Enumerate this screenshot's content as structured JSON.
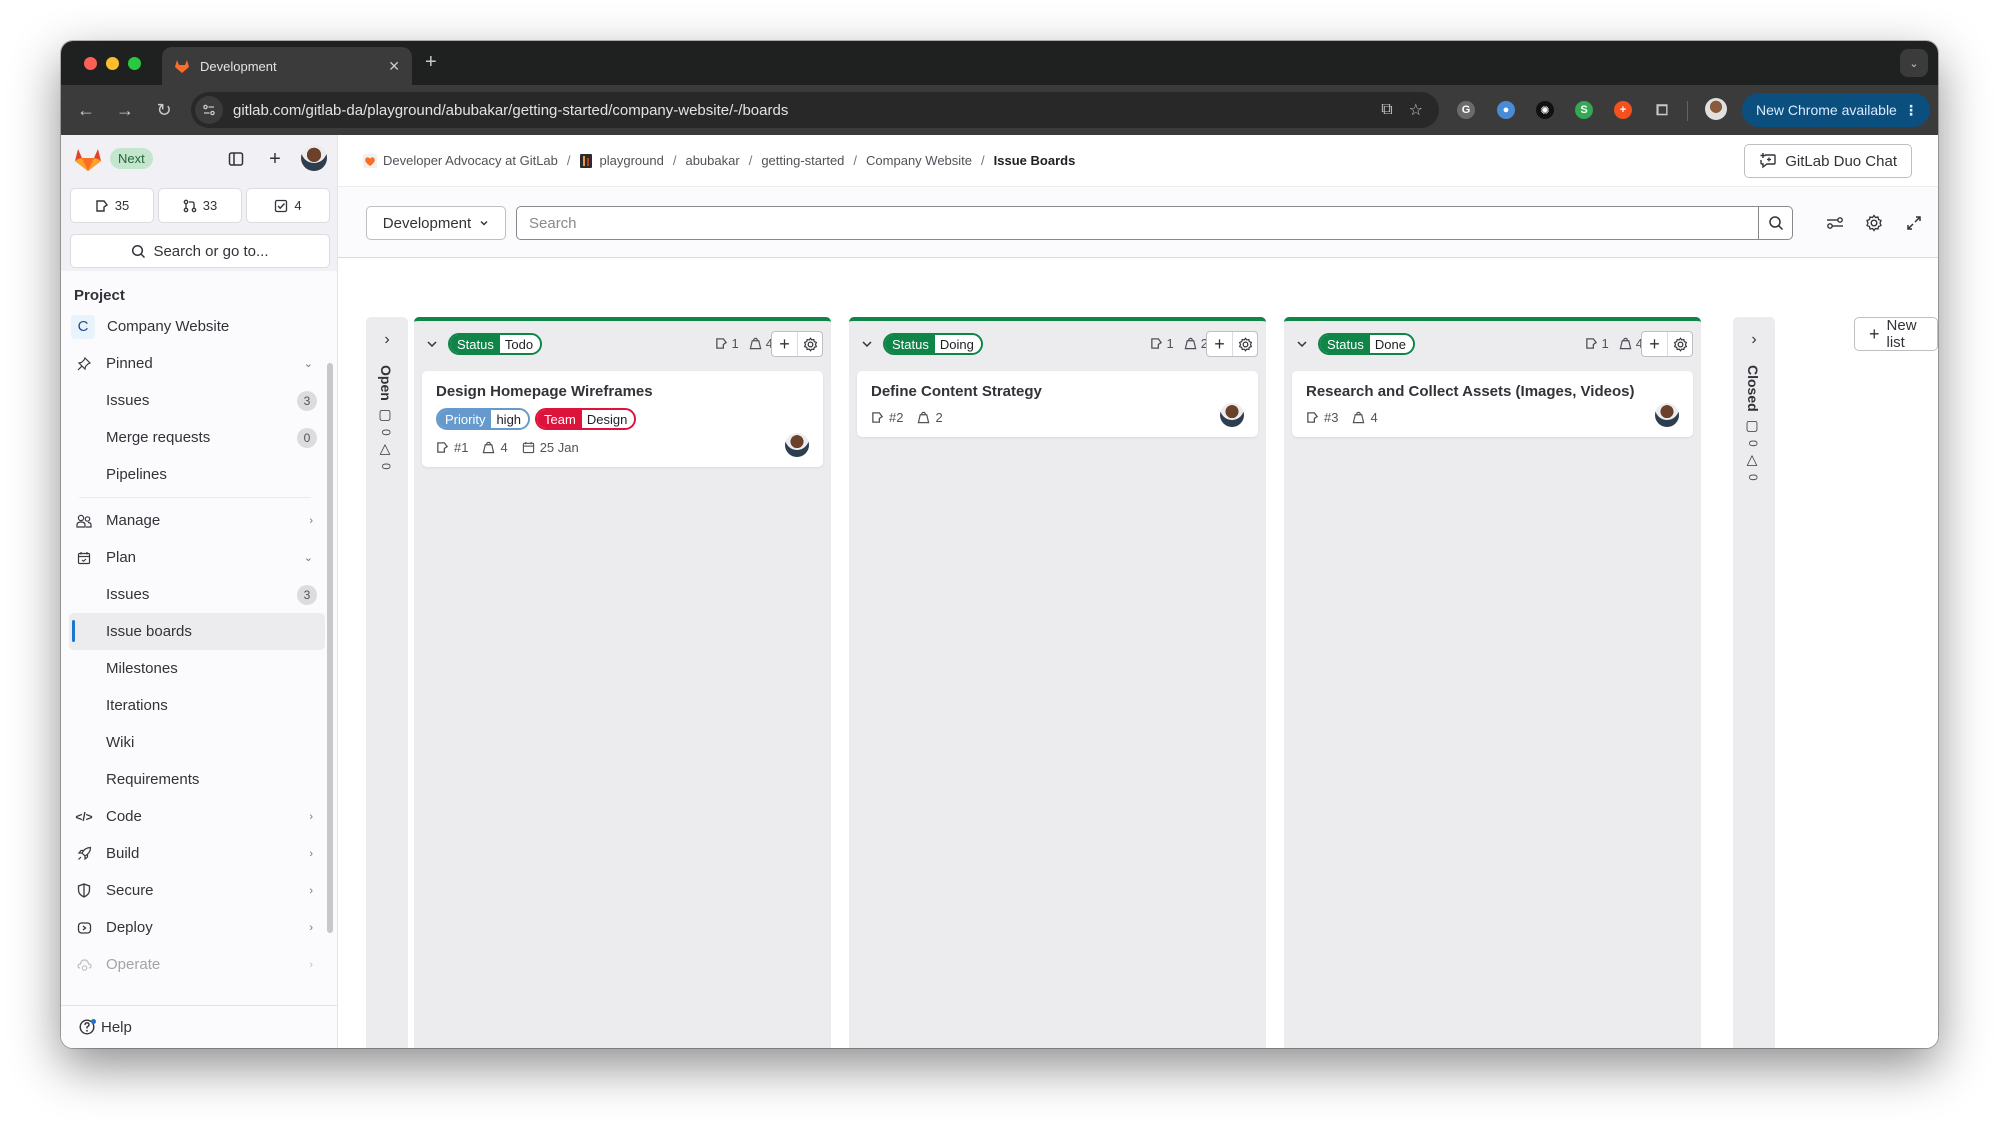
{
  "browser": {
    "tab_title": "Development",
    "url": "gitlab.com/gitlab-da/playground/abubakar/getting-started/company-website/-/boards",
    "update_button": "New Chrome available",
    "extensions": [
      {
        "name": "grammarly",
        "glyph": "G",
        "color": "#6b6b6b"
      },
      {
        "name": "extension-blue",
        "glyph": "●",
        "color": "#4a8bd6"
      },
      {
        "name": "extension-dark",
        "glyph": "✺",
        "color": "#111111"
      },
      {
        "name": "extension-green",
        "glyph": "S",
        "color": "#34a853"
      },
      {
        "name": "extension-orange",
        "glyph": "+",
        "color": "#f4511e"
      }
    ]
  },
  "sidebar": {
    "badge": "Next",
    "counters": [
      {
        "icon": "issues-icon",
        "count": "35"
      },
      {
        "icon": "merge-request-icon",
        "count": "33"
      },
      {
        "icon": "todo-icon",
        "count": "4"
      }
    ],
    "search_label": "Search or go to...",
    "section_title": "Project",
    "project": {
      "initial": "C",
      "name": "Company Website"
    },
    "items": [
      {
        "label": "Pinned",
        "icon": "pin-icon",
        "chevron": "down"
      },
      {
        "label": "Issues",
        "sub": true,
        "count": "3"
      },
      {
        "label": "Merge requests",
        "sub": true,
        "count": "0"
      },
      {
        "label": "Pipelines",
        "sub": true
      },
      {
        "label": "Manage",
        "icon": "users-icon",
        "chevron": "right"
      },
      {
        "label": "Plan",
        "icon": "calendar-icon",
        "chevron": "down"
      },
      {
        "label": "Issues",
        "sub": true,
        "count": "3"
      },
      {
        "label": "Issue boards",
        "sub": true,
        "active": true
      },
      {
        "label": "Milestones",
        "sub": true
      },
      {
        "label": "Iterations",
        "sub": true
      },
      {
        "label": "Wiki",
        "sub": true
      },
      {
        "label": "Requirements",
        "sub": true
      },
      {
        "label": "Code",
        "icon": "code-icon",
        "chevron": "right"
      },
      {
        "label": "Build",
        "icon": "rocket-icon",
        "chevron": "right"
      },
      {
        "label": "Secure",
        "icon": "shield-icon",
        "chevron": "right"
      },
      {
        "label": "Deploy",
        "icon": "deploy-icon",
        "chevron": "right"
      },
      {
        "label": "Operate",
        "icon": "cloud-icon",
        "chevron": "right",
        "faded": true
      }
    ],
    "help_label": "Help"
  },
  "breadcrumb": [
    {
      "label": "Developer Advocacy at GitLab",
      "icon": "group-avatar"
    },
    {
      "label": "playground",
      "icon": "subgroup-avatar"
    },
    {
      "label": "abubakar"
    },
    {
      "label": "getting-started"
    },
    {
      "label": "Company Website"
    },
    {
      "label": "Issue Boards",
      "current": true
    }
  ],
  "header": {
    "duo_chat_label": "GitLab Duo Chat"
  },
  "filter": {
    "board_name": "Development",
    "search_placeholder": "Search",
    "search_value": ""
  },
  "board": {
    "open_list": {
      "title": "Open",
      "issues": "0",
      "weight": "0"
    },
    "closed_list": {
      "title": "Closed",
      "issues": "0",
      "weight": "0"
    },
    "new_list_label": "New list",
    "lists": [
      {
        "label_key": "Status",
        "label_value": "Todo",
        "color": "#108548",
        "issue_count": "1",
        "weight": "4",
        "cards": [
          {
            "title": "Design Homepage Wireframes",
            "labels": [
              {
                "key": "Priority",
                "value": "high",
                "color": "#6699cc"
              },
              {
                "key": "Team",
                "value": "Design",
                "color": "#dc143c"
              }
            ],
            "number": "#1",
            "weight": "4",
            "due": "25 Jan"
          }
        ]
      },
      {
        "label_key": "Status",
        "label_value": "Doing",
        "color": "#108548",
        "issue_count": "1",
        "weight": "2",
        "cards": [
          {
            "title": "Define Content Strategy",
            "labels": [],
            "number": "#2",
            "weight": "2"
          }
        ]
      },
      {
        "label_key": "Status",
        "label_value": "Done",
        "color": "#108548",
        "issue_count": "1",
        "weight": "4",
        "cards": [
          {
            "title": "Research and Collect Assets (Images, Videos)",
            "labels": [],
            "number": "#3",
            "weight": "4"
          }
        ]
      }
    ]
  }
}
